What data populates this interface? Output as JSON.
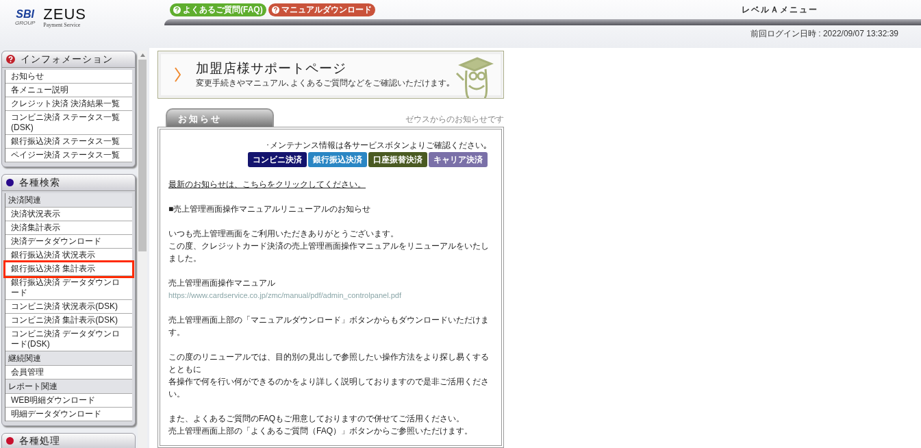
{
  "header": {
    "logo": {
      "group": "SBI",
      "group_sub": "GROUP",
      "brand": "ZEUS",
      "brand_sub": "Payment Service"
    },
    "buttons": [
      {
        "label": "よくあるご質問(FAQ)",
        "color": "#5fae2e"
      },
      {
        "label": "マニュアルダウンロード",
        "color": "#c9523a"
      }
    ],
    "title": "レベルＡメニュー",
    "last_login": "前回ログイン日時 : 2022/09/07 13:32:39"
  },
  "sidebar": {
    "panels": [
      {
        "title": "インフォメーション",
        "kind": "help",
        "groups": [
          {
            "items": [
              {
                "label": "お知らせ",
                "selected": false
              },
              {
                "label": "各メニュー説明",
                "selected": false
              },
              {
                "label": "クレジット決済 決済結果一覧",
                "selected": false
              },
              {
                "label": "コンビニ決済 ステータス一覧(DSK)",
                "selected": false
              },
              {
                "label": "銀行振込決済 ステータス一覧",
                "selected": false
              },
              {
                "label": "ペイジー決済 ステータス一覧",
                "selected": false
              }
            ]
          }
        ]
      },
      {
        "title": "各種検索",
        "kind": "dot",
        "color": "#2a0a8c",
        "groups": [
          {
            "heading": "決済関連",
            "items": [
              {
                "label": "決済状況表示",
                "selected": false
              },
              {
                "label": "決済集計表示",
                "selected": false
              },
              {
                "label": "決済データダウンロード",
                "selected": false
              },
              {
                "label": "銀行振込決済 状況表示",
                "selected": false
              },
              {
                "label": "銀行振込決済 集計表示",
                "selected": true
              },
              {
                "label": "銀行振込決済 データダウンロード",
                "selected": false
              },
              {
                "label": "コンビニ決済 状況表示(DSK)",
                "selected": false
              },
              {
                "label": "コンビニ決済 集計表示(DSK)",
                "selected": false
              },
              {
                "label": "コンビニ決済 データダウンロード(DSK)",
                "selected": false
              }
            ]
          },
          {
            "heading": "継続関連",
            "items": [
              {
                "label": "会員管理",
                "selected": false
              }
            ]
          },
          {
            "heading": "レポート関連",
            "items": [
              {
                "label": "WEB明細ダウンロード",
                "selected": false
              },
              {
                "label": "明細データダウンロード",
                "selected": false
              }
            ]
          }
        ]
      },
      {
        "title": "各種処理",
        "kind": "dot",
        "color": "#c8102e"
      }
    ]
  },
  "banner": {
    "title": "加盟店様サポートページ",
    "subtitle": "変更手続きやマニュアル､よくあるご質問などをご確認いただけます｡"
  },
  "notice": {
    "tab": "お知らせ",
    "caption": "ゼウスからのお知らせです",
    "hint": "･メンテナンス情報は各サービスボタンよりご確認ください｡",
    "services": [
      {
        "label": "コンビニ決済",
        "color": "#14146e"
      },
      {
        "label": "銀行振込決済",
        "color": "#2a86c4"
      },
      {
        "label": "口座振替決済",
        "color": "#4a5a22"
      },
      {
        "label": "キャリア決済",
        "color": "#7a70a8"
      }
    ],
    "blocks": [
      {
        "kind": "link",
        "lines": [
          "最新のお知らせは、こちらをクリックしてください。"
        ]
      },
      {
        "kind": "text",
        "lines": [
          "■売上管理画面操作マニュアルリニューアルのお知らせ"
        ]
      },
      {
        "kind": "text",
        "lines": [
          "いつも売上管理画面をご利用いただきありがとうございます。",
          "この度、クレジットカード決済の売上管理画面操作マニュアルをリニューアルをいたしました。"
        ]
      },
      {
        "kind": "text",
        "lines": [
          "売上管理画面操作マニュアル"
        ]
      },
      {
        "kind": "url",
        "lines": [
          "https://www.cardservice.co.jp/zmc/manual/pdf/admin_controlpanel.pdf"
        ]
      },
      {
        "kind": "text",
        "lines": [
          "売上管理画面上部の「マニュアルダウンロード」ボタンからもダウンロードいただけます。"
        ]
      },
      {
        "kind": "text",
        "lines": [
          "この度のリニューアルでは、目的別の見出しで参照したい操作方法をより探し易くするとともに",
          "各操作で何を行い何ができるのかをより詳しく説明しておりますので是非ご活用ください。"
        ]
      },
      {
        "kind": "text",
        "lines": [
          "また、よくあるご質問のFAQもご用意しておりますので併せてご活用ください。",
          "売上管理画面上部の「よくあるご質問（FAQ）」ボタンからご参照いただけます。"
        ]
      }
    ]
  }
}
